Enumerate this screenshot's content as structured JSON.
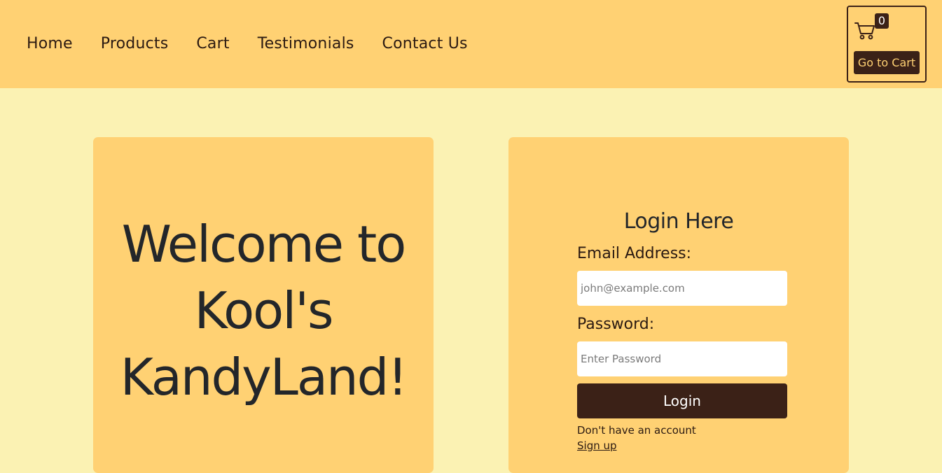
{
  "nav": {
    "items": [
      {
        "label": "Home"
      },
      {
        "label": "Products"
      },
      {
        "label": "Cart"
      },
      {
        "label": "Testimonials"
      },
      {
        "label": "Contact Us"
      }
    ]
  },
  "cart": {
    "count": "0",
    "icon": "shopping-cart-icon",
    "button_label": "Go to Cart"
  },
  "hero": {
    "line1": "Welcome to",
    "line2": "Kool's",
    "line3": "KandyLand!"
  },
  "login": {
    "title": "Login Here",
    "email_label": "Email Address:",
    "email_placeholder": "john@example.com",
    "email_value": "",
    "password_label": "Password:",
    "password_placeholder": "Enter Password",
    "password_value": "",
    "submit_label": "Login",
    "no_account_text": "Don't have an account",
    "signup_link": "Sign up"
  },
  "colors": {
    "page_background": "#fbf2b3",
    "header_background": "#ffd173",
    "card_background": "#ffd173",
    "button_background": "#3b2117",
    "button_text": "#ffffff",
    "cart_button_text": "#ffd173"
  }
}
